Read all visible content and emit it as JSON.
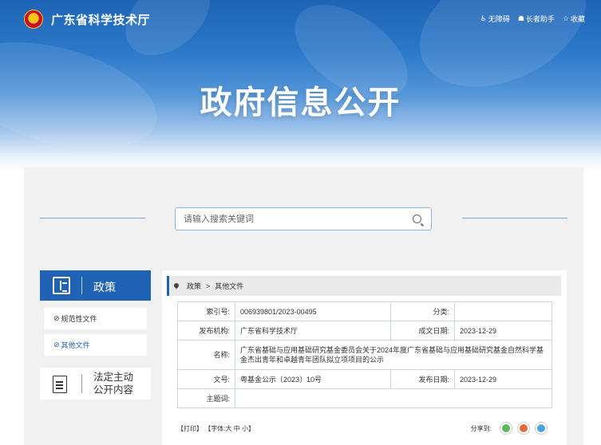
{
  "site": {
    "name": "广东省科学技术厅"
  },
  "toolbar": {
    "accessibility": "无障碍",
    "elder": "长者助手",
    "favorite": "收藏"
  },
  "hero": {
    "title": "政府信息公开"
  },
  "search": {
    "placeholder": "请输入搜索关键词"
  },
  "sidebar": {
    "header": "政策",
    "items": [
      {
        "label": "规范性文件"
      },
      {
        "label": "其他文件"
      }
    ],
    "open_section": {
      "line1": "法定主动",
      "line2": "公开内容"
    }
  },
  "breadcrumb": {
    "level1": "政策",
    "separator": ">",
    "level2": "其他文件"
  },
  "meta": {
    "index_label": "索引号:",
    "index_value": "006939801/2023-00495",
    "category_label": "分类:",
    "category_value": "",
    "issuer_label": "发布机构:",
    "issuer_value": "广东省科学技术厅",
    "created_label": "成文日期:",
    "created_value": "2023-12-29",
    "name_label": "名称:",
    "name_value": "广东省基础与应用基础研究基金委员会关于2024年度广东省基础与应用基础研究基金自然科学基金杰出青年和卓越青年团队拟立项项目的公示",
    "docno_label": "文号:",
    "docno_value": "粤基金公示〔2023〕10号",
    "published_label": "发布日期:",
    "published_value": "2023-12-29",
    "subject_label": "主题词:",
    "subject_value": ""
  },
  "footer": {
    "print": "【打印】",
    "font_label": "【字体:",
    "font_large": "大",
    "font_medium": "中",
    "font_small": "小",
    "font_close": "】",
    "share_label": "分享到:"
  },
  "colors": {
    "primary": "#1f63b5",
    "panel": "#f1f1f1",
    "wechat": "#5cb85c",
    "weibo": "#e8693a",
    "qq": "#4aa3e0"
  }
}
